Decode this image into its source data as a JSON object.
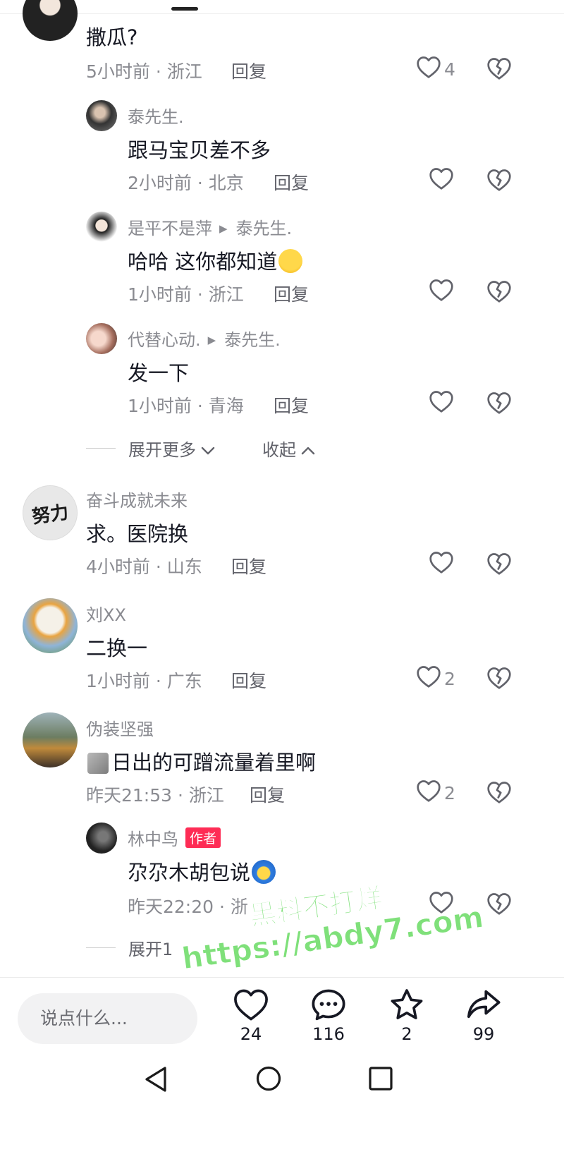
{
  "comments": [
    {
      "name": "",
      "text": "撒瓜?",
      "time": "5小时前",
      "location": "浙江",
      "reply": "回复",
      "likes": "4"
    },
    {
      "name": "泰先生.",
      "text": "跟马宝贝差不多",
      "time": "2小时前",
      "location": "北京",
      "reply": "回复",
      "likes": ""
    },
    {
      "name": "是平不是萍",
      "reply_to": "泰先生.",
      "text": "哈哈 这你都知道",
      "time": "1小时前",
      "location": "浙江",
      "reply": "回复",
      "likes": ""
    },
    {
      "name": "代替心动.",
      "reply_to": "泰先生.",
      "text": "发一下",
      "time": "1小时前",
      "location": "青海",
      "reply": "回复",
      "likes": ""
    },
    {
      "name": "奋斗成就未来",
      "text": "求。医院换",
      "time": "4小时前",
      "location": "山东",
      "reply": "回复",
      "likes": ""
    },
    {
      "name": "刘XX",
      "text": "二换一",
      "time": "1小时前",
      "location": "广东",
      "reply": "回复",
      "likes": "2"
    },
    {
      "name": "伪装坚强",
      "text": "日出的可蹭流量着里啊",
      "time": "昨天21:53",
      "location": "浙江",
      "reply": "回复",
      "likes": "2"
    },
    {
      "name": "林中鸟",
      "badge": "作者",
      "text": "尕尕木胡包说",
      "time": "昨天22:20",
      "location": "浙",
      "reply": "",
      "likes": ""
    }
  ],
  "separator": "·",
  "thread_controls": {
    "expand_more": "展开更多",
    "collapse": "收起",
    "expand_one": "展开1"
  },
  "avatar_texts": {
    "fendou": "努力"
  },
  "bottom": {
    "input_placeholder": "说点什么...",
    "likes": "24",
    "comments": "116",
    "favorites": "2",
    "shares": "99"
  },
  "watermark": {
    "line1": "黑料不打烊",
    "line2": "https://abdy7.com"
  },
  "colors": {
    "accent": "#fe2c55",
    "watermark": "#7fe07a",
    "text_secondary": "#8a8b91"
  },
  "icons": {
    "like": "heart-outline-icon",
    "dislike": "broken-heart-icon",
    "comment": "comment-bubble-icon",
    "favorite": "star-outline-icon",
    "share": "share-arrow-icon"
  }
}
